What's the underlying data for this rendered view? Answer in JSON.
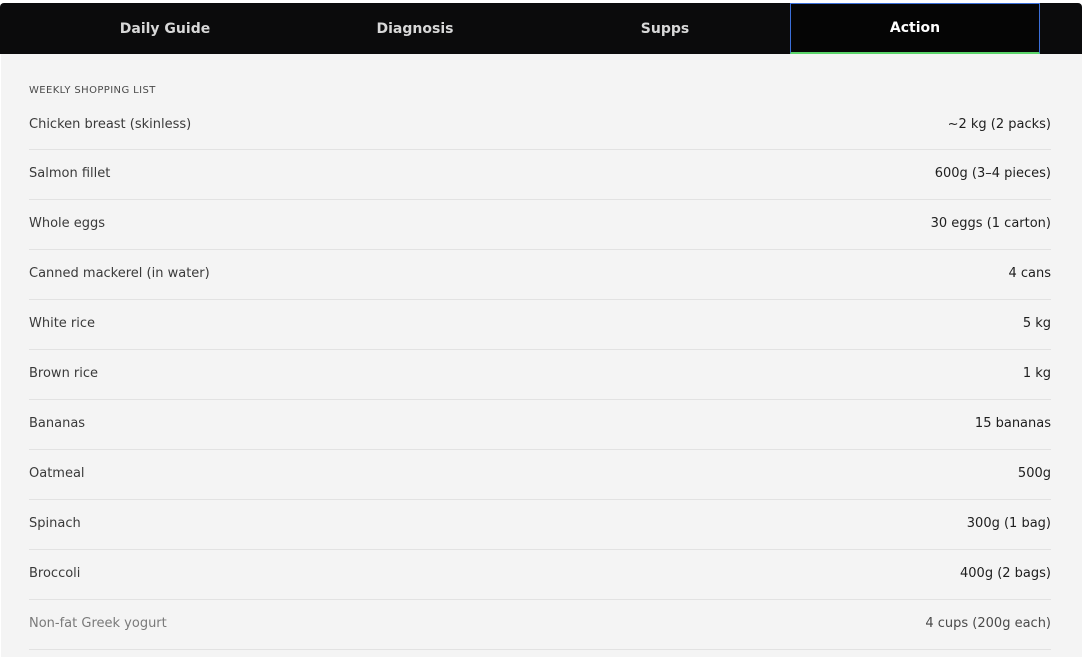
{
  "tabs": [
    {
      "label": "Daily Guide",
      "active": false
    },
    {
      "label": "Diagnosis",
      "active": false
    },
    {
      "label": "Supps",
      "active": false
    },
    {
      "label": "Action",
      "active": true
    }
  ],
  "colors": {
    "tabbar_bg": "#0b0b0c",
    "panel_bg": "#f4f4f4",
    "active_tab_border": "#3b6fd9",
    "active_tab_underline": "#5ad46a"
  },
  "shopping_list": {
    "heading": "WEEKLY SHOPPING LIST",
    "items": [
      {
        "name": "Chicken breast (skinless)",
        "qty": "~2 kg (2 packs)"
      },
      {
        "name": "Salmon fillet",
        "qty": "600g (3–4 pieces)"
      },
      {
        "name": "Whole eggs",
        "qty": "30 eggs (1 carton)"
      },
      {
        "name": "Canned mackerel (in water)",
        "qty": "4 cans"
      },
      {
        "name": "White rice",
        "qty": "5 kg"
      },
      {
        "name": "Brown rice",
        "qty": "1 kg"
      },
      {
        "name": "Bananas",
        "qty": "15 bananas"
      },
      {
        "name": "Oatmeal",
        "qty": "500g"
      },
      {
        "name": "Spinach",
        "qty": "300g (1 bag)"
      },
      {
        "name": "Broccoli",
        "qty": "400g (2 bags)"
      },
      {
        "name": "Non-fat Greek yogurt",
        "qty": "4 cups (200g each)"
      }
    ]
  }
}
